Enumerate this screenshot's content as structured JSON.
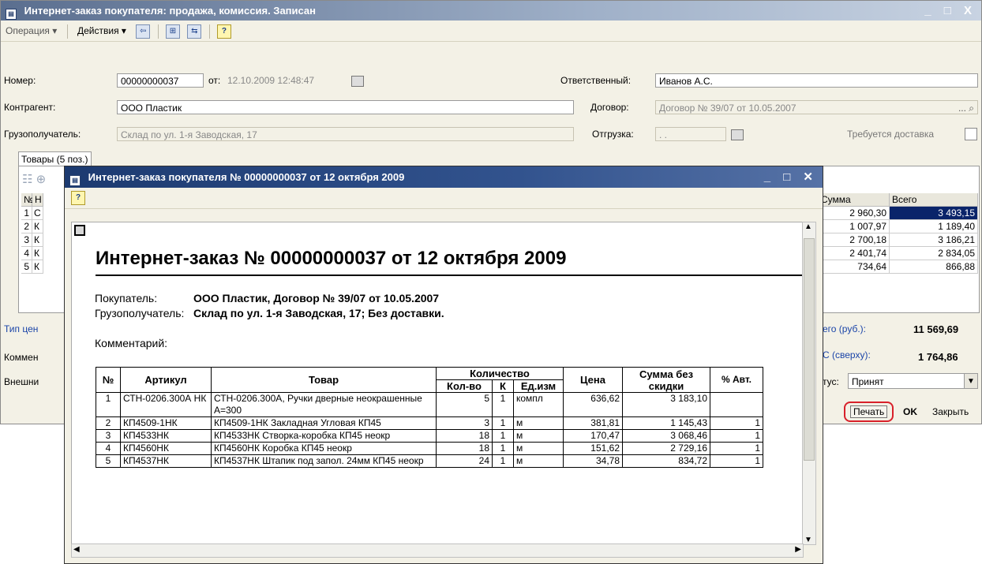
{
  "main_window": {
    "title": "Интернет-заказ покупателя: продажа, комиссия. Записан",
    "window_controls": "_ □ X",
    "toolbar": {
      "operation": "Операция ▾",
      "actions": "Действия ▾",
      "help_icon": "?"
    },
    "form": {
      "number_label": "Номер:",
      "number_value": "00000000037",
      "date_label": "от:",
      "date_value": "12.10.2009 12:48:47",
      "responsible_label": "Ответственный:",
      "responsible_value": "Иванов А.С.",
      "counterparty_label": "Контрагент:",
      "counterparty_value": "ООО Пластик",
      "contract_label": "Договор:",
      "contract_value": "Договор № 39/07 от 10.05.2007",
      "consignee_label": "Грузополучатель:",
      "consignee_value": "Склад по ул. 1-я Заводская, 17",
      "shipment_label": "Отгрузка:",
      "shipment_value": ". .",
      "delivery_label": "Требуется доставка"
    },
    "tab_goods": "Товары (5 поз.)",
    "grid": {
      "col_no": "№",
      "col_name": "Н",
      "col_sum": "Сумма",
      "col_total": "Всего",
      "rows": [
        {
          "no": "1",
          "name": "С",
          "sum": "2 960,30",
          "total": "3 493,15"
        },
        {
          "no": "2",
          "name": "К",
          "sum": "1 007,97",
          "total": "1 189,40"
        },
        {
          "no": "3",
          "name": "К",
          "sum": "2 700,18",
          "total": "3 186,21"
        },
        {
          "no": "4",
          "name": "К",
          "sum": "2 401,74",
          "total": "2 834,05"
        },
        {
          "no": "5",
          "name": "К",
          "sum": "734,64",
          "total": "866,88"
        }
      ]
    },
    "price_type_label": "Тип цен",
    "comment_label": "Коммен",
    "external_label": "Внешни",
    "total_label": "его (руб.):",
    "total_value": "11 569,69",
    "vat_label": "С (сверху):",
    "vat_value": "1 764,86",
    "status_label": "тус:",
    "status_value": "Принят",
    "print_button": "Печать",
    "ok_button": "OK",
    "close_button": "Закрыть"
  },
  "print_window": {
    "title": "Интернет-заказ покупателя № 00000000037 от 12 октября 2009",
    "window_controls": "_ □ ✕",
    "help_icon": "?",
    "doc": {
      "heading": "Интернет-заказ № 00000000037 от 12 октября 2009",
      "buyer_label": "Покупатель:",
      "buyer_value": "ООО Пластик, Договор № 39/07 от 10.05.2007",
      "consignee_label": "Грузополучатель:",
      "consignee_value": "Склад по ул. 1-я Заводская, 17; Без доставки.",
      "comment_label": "Комментарий:",
      "table": {
        "h_no": "№",
        "h_article": "Артикул",
        "h_goods": "Товар",
        "h_quantity": "Количество",
        "h_qty": "Кол-во",
        "h_k": "К",
        "h_unit": "Ед.изм",
        "h_price": "Цена",
        "h_sum_no_disc": "Сумма без скидки",
        "h_auto": "% Авт.",
        "rows": [
          {
            "no": "1",
            "article": "СТН-0206.300А НК",
            "goods": "СТН-0206.300А, Ручки дверные неокрашенные А=300",
            "qty": "5",
            "k": "1",
            "unit": "компл",
            "price": "636,62",
            "sum": "3 183,10",
            "auto": ""
          },
          {
            "no": "2",
            "article": "КП4509-1НК",
            "goods": "КП4509-1НК Закладная Угловая КП45",
            "qty": "3",
            "k": "1",
            "unit": "м",
            "price": "381,81",
            "sum": "1 145,43",
            "auto": "1"
          },
          {
            "no": "3",
            "article": "КП4533НК",
            "goods": "КП4533НК Створка-коробка КП45 неокр",
            "qty": "18",
            "k": "1",
            "unit": "м",
            "price": "170,47",
            "sum": "3 068,46",
            "auto": "1"
          },
          {
            "no": "4",
            "article": "КП4560НК",
            "goods": "КП4560НК Коробка КП45 неокр",
            "qty": "18",
            "k": "1",
            "unit": "м",
            "price": "151,62",
            "sum": "2 729,16",
            "auto": "1"
          },
          {
            "no": "5",
            "article": "КП4537НК",
            "goods": "КП4537НК Штапик под запол. 24мм КП45 неокр",
            "qty": "24",
            "k": "1",
            "unit": "м",
            "price": "34,78",
            "sum": "834,72",
            "auto": "1"
          }
        ]
      }
    }
  }
}
